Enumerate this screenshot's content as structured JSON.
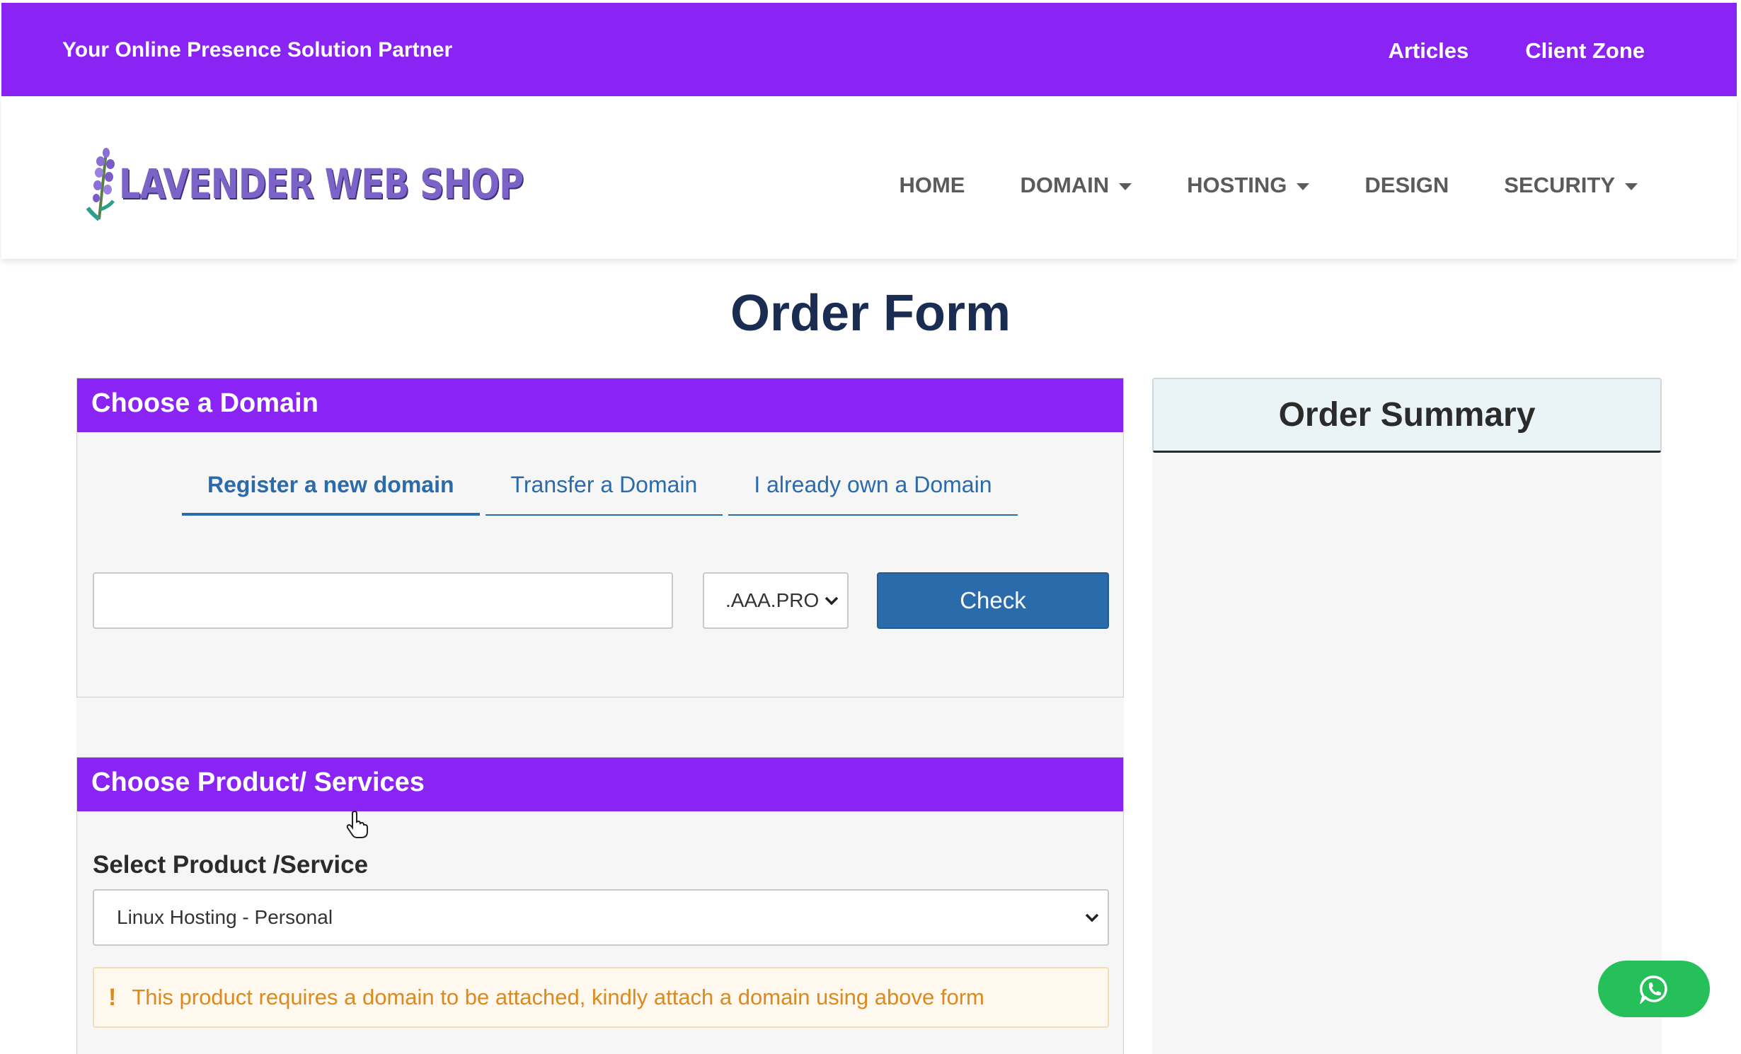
{
  "topbar": {
    "tagline": "Your Online Presence Solution Partner",
    "links": [
      "Articles",
      "Client Zone"
    ]
  },
  "header": {
    "logo_text": "LAVENDER WEB SHOP",
    "nav": [
      {
        "label": "HOME",
        "dropdown": false
      },
      {
        "label": "DOMAIN",
        "dropdown": true
      },
      {
        "label": "HOSTING",
        "dropdown": true
      },
      {
        "label": "DESIGN",
        "dropdown": false
      },
      {
        "label": "SECURITY",
        "dropdown": true
      }
    ]
  },
  "page": {
    "title": "Order Form"
  },
  "domain_section": {
    "heading": "Choose a Domain",
    "tabs": [
      "Register a new domain",
      "Transfer a Domain",
      "I already own a Domain"
    ],
    "active_tab": "Register a new domain",
    "input_value": "",
    "tld_selected": ".AAA.PRO",
    "check_label": "Check"
  },
  "product_section": {
    "heading": "Choose Product/ Services",
    "select_label": "Select Product /Service",
    "selected_product": "Linux Hosting - Personal",
    "alert_icon": "!",
    "alert_text": "This product requires a domain to be attached, kindly attach a domain using above form"
  },
  "summary": {
    "title": "Order Summary"
  },
  "colors": {
    "brand_purple": "#8a24f5",
    "link_blue": "#2a6bab",
    "title_navy": "#1b2c52",
    "warning_orange": "#dc8a1d",
    "whatsapp_green": "#25c05a"
  },
  "icons": {
    "whatsapp": "whatsapp-icon",
    "caret": "caret-down-icon",
    "select_chevron": "chevron-down-icon"
  }
}
